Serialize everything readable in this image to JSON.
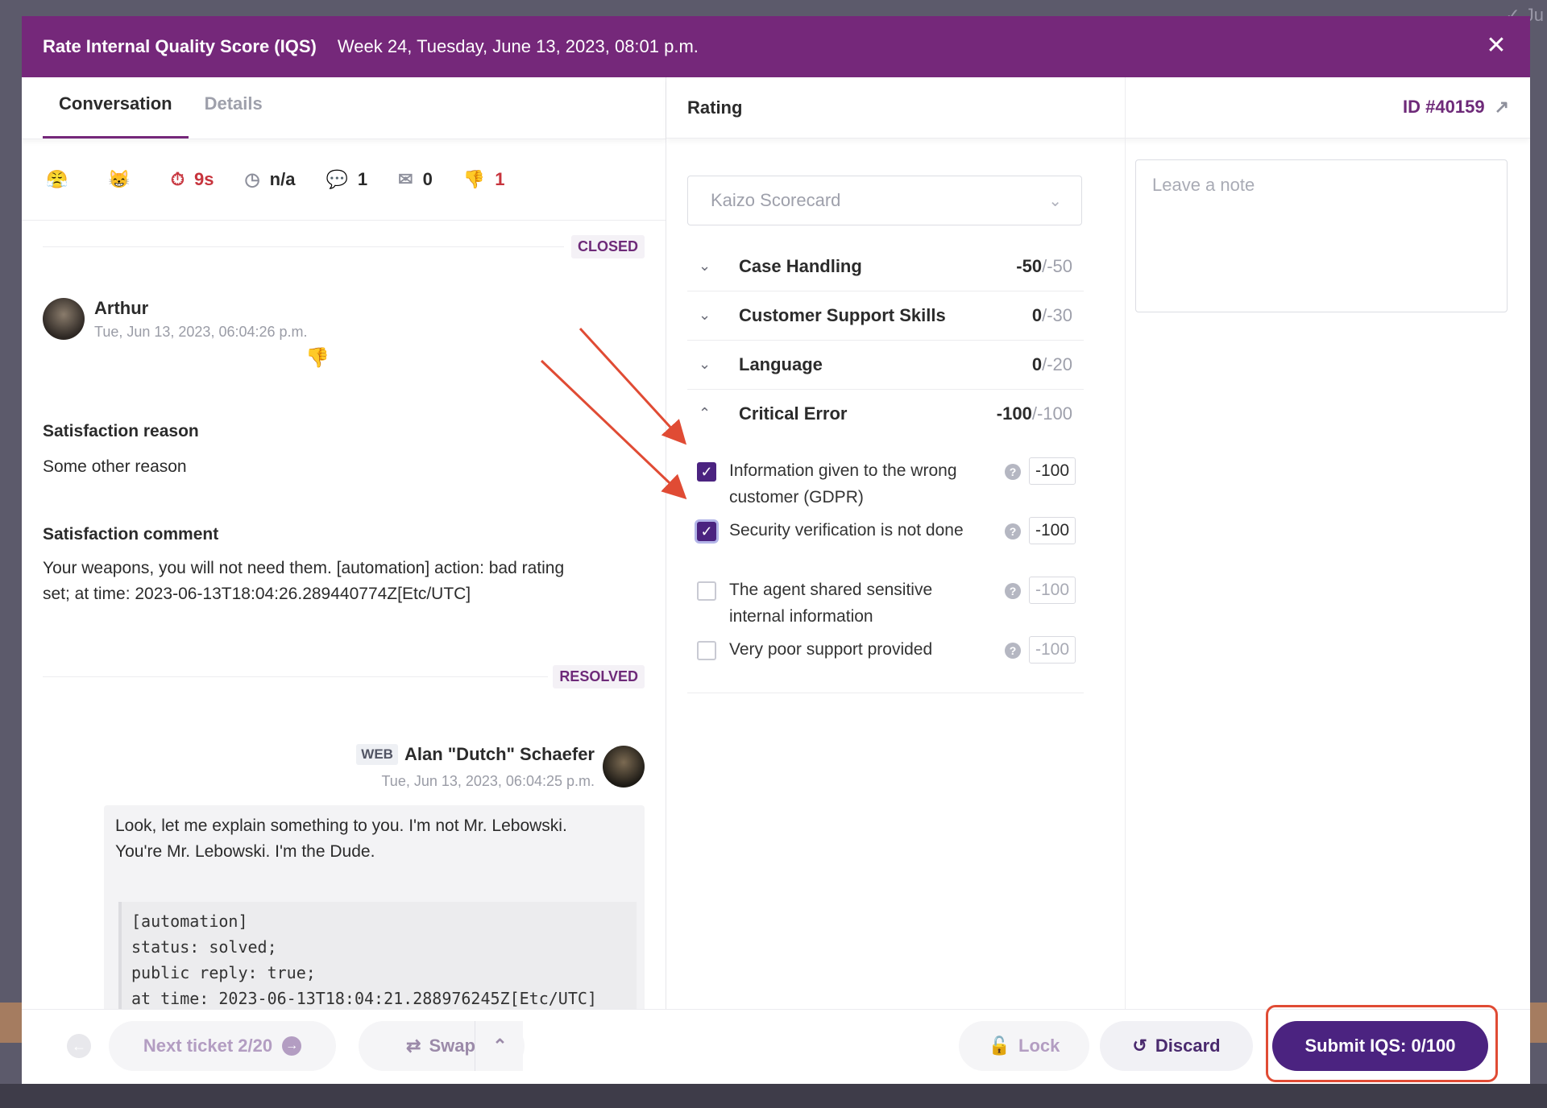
{
  "header": {
    "title": "Rate Internal Quality Score (IQS)",
    "subtitle": "Week 24, Tuesday, June 13, 2023, 08:01 p.m.",
    "close_glyph": "✕"
  },
  "left_tabs": [
    {
      "label": "Conversation"
    },
    {
      "label": "Details"
    }
  ],
  "stats": {
    "reply_time": "9s",
    "resolution_time": "n/a",
    "messages": "1",
    "public_replies": "0",
    "bad_ratings": "1"
  },
  "conversation": {
    "status_closed": "CLOSED",
    "status_resolved": "RESOLVED",
    "customer": {
      "name": "Arthur",
      "time": "Tue, Jun 13, 2023, 06:04:26 p.m."
    },
    "satisfaction_reason_label": "Satisfaction reason",
    "satisfaction_reason": "Some other reason",
    "satisfaction_comment_label": "Satisfaction comment",
    "satisfaction_comment": "Your weapons, you will not need them. [automation] action: bad rating set; at time: 2023-06-13T18:04:26.289440774Z[Etc/UTC]",
    "agent": {
      "channel": "WEB",
      "name": "Alan \"Dutch\" Schaefer",
      "time": "Tue, Jun 13, 2023, 06:04:25 p.m.",
      "message": "Look, let me explain something to you. I'm not Mr. Lebowski. You're Mr. Lebowski. I'm the Dude.",
      "code": "[automation]\nstatus: solved;\npublic reply: true;\nat time: 2023-06-13T18:04:21.288976245Z[Etc/UTC]"
    }
  },
  "rating": {
    "title": "Rating",
    "id_label": "ID #40159",
    "scorecard_placeholder": "Kaizo Scorecard",
    "categories": [
      {
        "name": "Case Handling",
        "score": "-50",
        "max": "/-50",
        "expanded": false
      },
      {
        "name": "Customer Support Skills",
        "score": "0",
        "max": "/-30",
        "expanded": false
      },
      {
        "name": "Language",
        "score": "0",
        "max": "/-20",
        "expanded": false
      },
      {
        "name": "Critical Error",
        "score": "-100",
        "max": "/-100",
        "expanded": true
      }
    ],
    "critical_items": [
      {
        "label": "Information given to the wrong customer (GDPR)",
        "points": "-100",
        "checked": true
      },
      {
        "label": "Security verification is not done",
        "points": "-100",
        "checked": true
      },
      {
        "label": "The agent shared sensitive internal information",
        "points": "-100",
        "checked": false
      },
      {
        "label": "Very poor support provided",
        "points": "-100",
        "checked": false
      }
    ]
  },
  "note": {
    "placeholder": "Leave a note"
  },
  "footer": {
    "next_ticket": "Next ticket 2/20",
    "swap": "Swap",
    "lock": "Lock",
    "discard": "Discard",
    "submit": "Submit IQS: 0/100"
  },
  "colors": {
    "brand": "#75287a",
    "primary_button": "#4b2380",
    "alert_red": "#c7343d",
    "annotation": "#e04b34"
  }
}
